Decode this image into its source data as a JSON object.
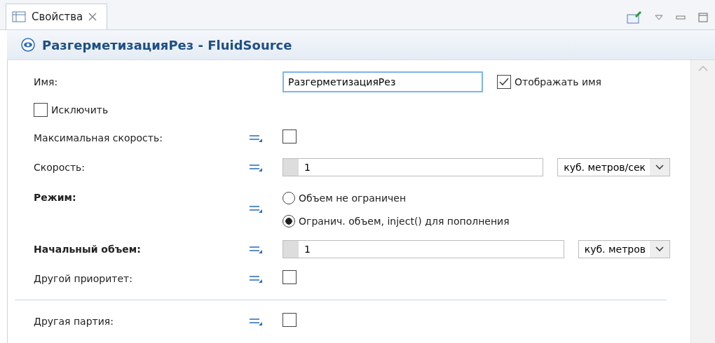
{
  "tab": {
    "label": "Свойства",
    "selected": true
  },
  "header": {
    "title": "РазгерметизацияРез - FluidSource"
  },
  "rows": [
    {
      "kind": "name",
      "label": "Имя:",
      "value": "РазгерметизацияРез",
      "show_name": {
        "label": "Отображать имя",
        "checked": true
      }
    },
    {
      "kind": "flag",
      "label": "Исключить",
      "checked": false
    },
    {
      "kind": "checkbox",
      "label": "Максимальная скорость:",
      "bold": false,
      "checked": false
    },
    {
      "kind": "number",
      "label": "Скорость:",
      "bold": false,
      "value": "1",
      "unit": "куб. метров/сек"
    },
    {
      "kind": "radio",
      "label": "Режим:",
      "bold": true,
      "options": [
        {
          "label": "Объем не ограничен",
          "selected": false
        },
        {
          "label": "Огранич. объем, inject() для пополнения",
          "selected": true
        }
      ]
    },
    {
      "kind": "number",
      "label": "Начальный объем:",
      "bold": true,
      "value": "1",
      "unit": "куб. метров"
    },
    {
      "kind": "checkbox",
      "label": "Другой приоритет:",
      "bold": false,
      "checked": false
    },
    {
      "kind": "divider"
    },
    {
      "kind": "checkbox",
      "label": "Другая партия:",
      "bold": false,
      "checked": false
    }
  ]
}
